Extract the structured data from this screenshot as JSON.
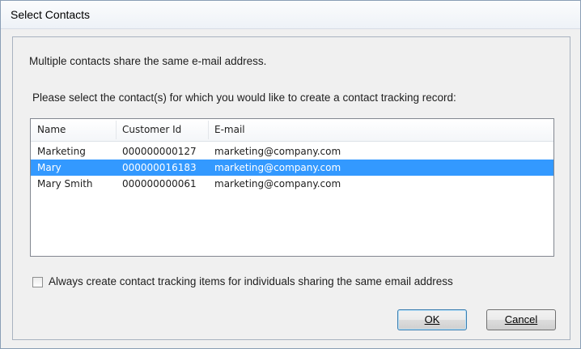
{
  "window": {
    "title": "Select Contacts"
  },
  "message": "Multiple contacts share the same e-mail address.",
  "prompt": "Please select the contact(s) for which you would like to create a contact tracking record:",
  "list": {
    "columns": [
      "Name",
      "Customer Id",
      "E-mail"
    ],
    "rows": [
      {
        "name": "Marketing",
        "customer_id": "000000000127",
        "email": "marketing@company.com",
        "selected": false
      },
      {
        "name": "Mary",
        "customer_id": "000000016183",
        "email": "marketing@company.com",
        "selected": true
      },
      {
        "name": "Mary Smith",
        "customer_id": "000000000061",
        "email": "marketing@company.com",
        "selected": false
      }
    ],
    "selected_color": "#3399ff"
  },
  "checkbox": {
    "label": "Always create contact tracking items for individuals sharing the same email address",
    "checked": false
  },
  "buttons": {
    "ok_label": "OK",
    "cancel_label": "Cancel"
  }
}
